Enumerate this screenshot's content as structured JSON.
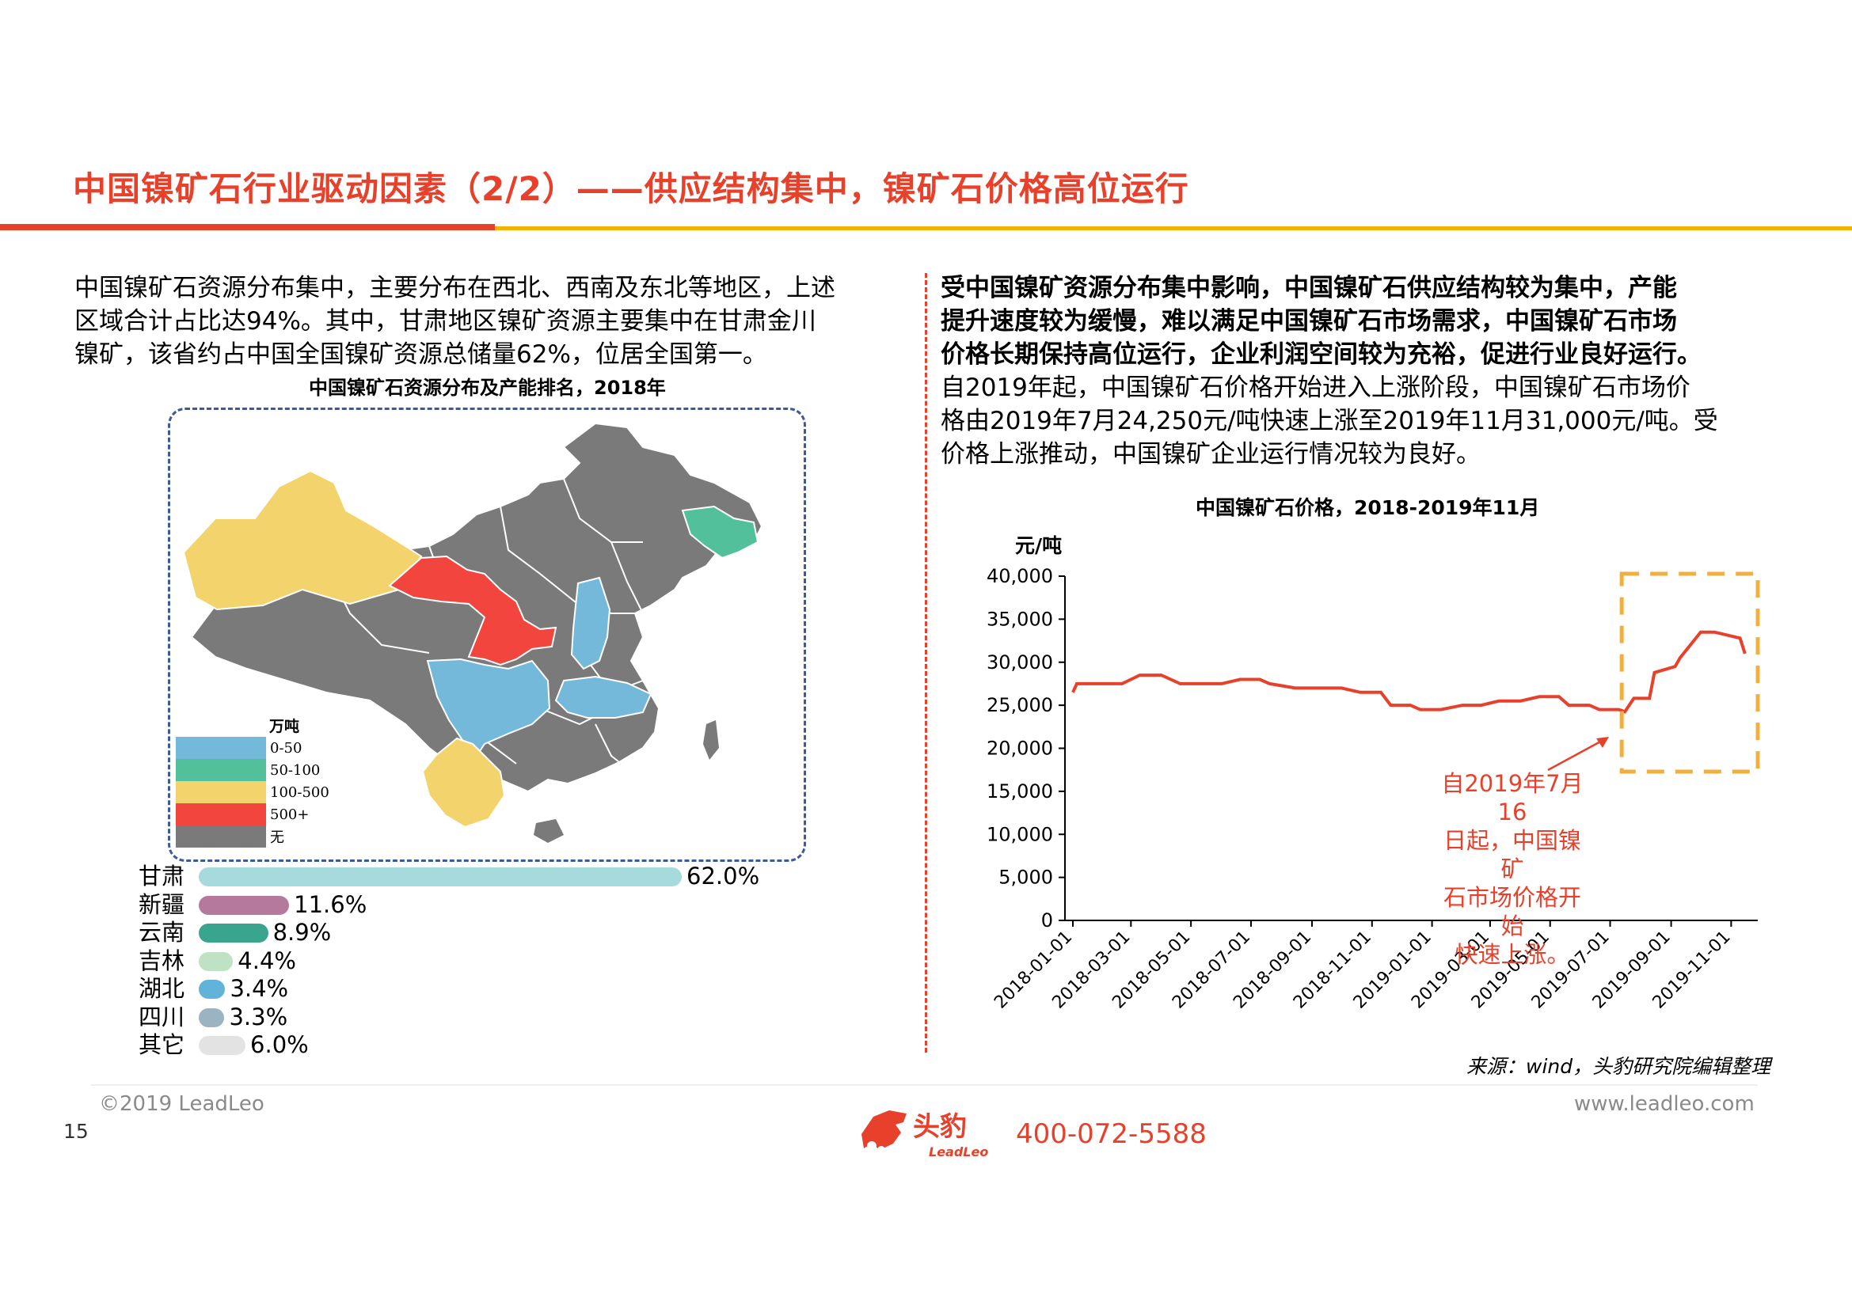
{
  "header": {
    "title": "中国镍矿石行业驱动因素（2/2）——供应结构集中，镍矿石价格高位运行"
  },
  "left_text": {
    "lines": [
      "中国镍矿石资源分布集中，主要分布在西北、西南及东北等地区，上述",
      "区域合计占比达94%。其中，甘肃地区镍矿资源主要集中在甘肃金川",
      "镍矿，该省约占中国全国镍矿资源总储量62%，位居全国第一。"
    ]
  },
  "right_text": {
    "bold_lines": [
      "受中国镍矿资源分布集中影响，中国镍矿石供应结构较为集中，产能",
      "提升速度较为缓慢，难以满足中国镍矿石市场需求，中国镍矿石市场",
      "价格长期保持高位运行，企业利润空间较为充裕，促进行业良好运行。"
    ],
    "normal_lines": [
      "自2019年起，中国镍矿石价格开始进入上涨阶段，中国镍矿石市场价",
      "格由2019年7月24,250元/吨快速上涨至2019年11月31,000元/吨。受",
      "价格上涨推动，中国镍矿企业运行情况较为良好。"
    ]
  },
  "map": {
    "title": "中国镍矿石资源分布及产能排名，2018年",
    "legend_unit": "万吨",
    "legend": [
      {
        "label": "0-50",
        "color": "#74b9d9"
      },
      {
        "label": "50-100",
        "color": "#52c19b"
      },
      {
        "label": "100-500",
        "color": "#f3d36b"
      },
      {
        "label": "500+",
        "color": "#f2453d"
      },
      {
        "label": "无",
        "color": "#7a7a7a"
      }
    ],
    "ranking": [
      {
        "name": "甘肃",
        "value_label": "62.0%",
        "value": 62.0,
        "color": "#a6dadc"
      },
      {
        "name": "新疆",
        "value_label": "11.6%",
        "value": 11.6,
        "color": "#b5799e"
      },
      {
        "name": "云南",
        "value_label": "8.9%",
        "value": 8.9,
        "color": "#3aa58f"
      },
      {
        "name": "吉林",
        "value_label": "4.4%",
        "value": 4.4,
        "color": "#bfe2c4"
      },
      {
        "name": "湖北",
        "value_label": "3.4%",
        "value": 3.4,
        "color": "#62b3d8"
      },
      {
        "name": "四川",
        "value_label": "3.3%",
        "value": 3.3,
        "color": "#9bb4c2"
      },
      {
        "name": "其它",
        "value_label": "6.0%",
        "value": 6.0,
        "color": "#e3e3e3"
      }
    ]
  },
  "chart_data": {
    "type": "line",
    "title": "中国镍矿石价格，2018-2019年11月",
    "ylabel": "元/吨",
    "ylim": [
      0,
      40000
    ],
    "yticks": [
      "0",
      "5,000",
      "10,000",
      "15,000",
      "20,000",
      "25,000",
      "30,000",
      "35,000",
      "40,000"
    ],
    "xticks": [
      "2018-01-01",
      "2018-03-01",
      "2018-05-01",
      "2018-07-01",
      "2018-09-01",
      "2018-11-01",
      "2019-01-01",
      "2019-03-01",
      "2019-05-01",
      "2019-07-01",
      "2019-09-01",
      "2019-11-01"
    ],
    "line_color": "#e8412b",
    "series": [
      {
        "x": [
          "2018-01-01",
          "2018-01-05",
          "2018-02-01",
          "2018-02-20",
          "2018-03-01",
          "2018-03-10",
          "2018-04-01",
          "2018-04-20",
          "2018-05-15",
          "2018-06-01",
          "2018-06-20",
          "2018-07-10",
          "2018-07-20",
          "2018-08-15",
          "2018-09-01",
          "2018-10-01",
          "2018-10-20",
          "2018-11-10",
          "2018-11-20",
          "2018-12-10",
          "2018-12-20",
          "2019-01-10",
          "2019-02-01",
          "2019-02-20",
          "2019-03-10",
          "2019-04-01",
          "2019-04-20",
          "2019-05-10",
          "2019-05-20",
          "2019-06-10",
          "2019-06-20",
          "2019-07-10",
          "2019-07-16",
          "2019-07-25",
          "2019-08-10",
          "2019-08-15",
          "2019-09-05",
          "2019-09-10",
          "2019-10-01",
          "2019-10-15",
          "2019-11-10",
          "2019-11-15"
        ],
        "values": [
          26500,
          27500,
          27500,
          27500,
          28000,
          28500,
          28500,
          27500,
          27500,
          27500,
          28000,
          28000,
          27500,
          27000,
          27000,
          27000,
          26500,
          26500,
          25000,
          25000,
          24500,
          24500,
          25000,
          25000,
          25500,
          25500,
          26000,
          26000,
          25000,
          25000,
          24500,
          24500,
          24250,
          25800,
          25800,
          28800,
          29500,
          30500,
          33500,
          33500,
          32800,
          31000
        ]
      }
    ],
    "annotation": [
      "自2019年7月16",
      "日起，中国镍矿",
      "石市场价格开始",
      "快速上涨。"
    ]
  },
  "footer": {
    "source": "来源：wind，头豹研究院编辑整理",
    "copyright": "©2019 LeadLeo",
    "website": "www.leadleo.com",
    "page_number": "15",
    "phone": "400-072-5588",
    "logo_text": "头豹",
    "logo_subtext": "LeadLeo"
  }
}
